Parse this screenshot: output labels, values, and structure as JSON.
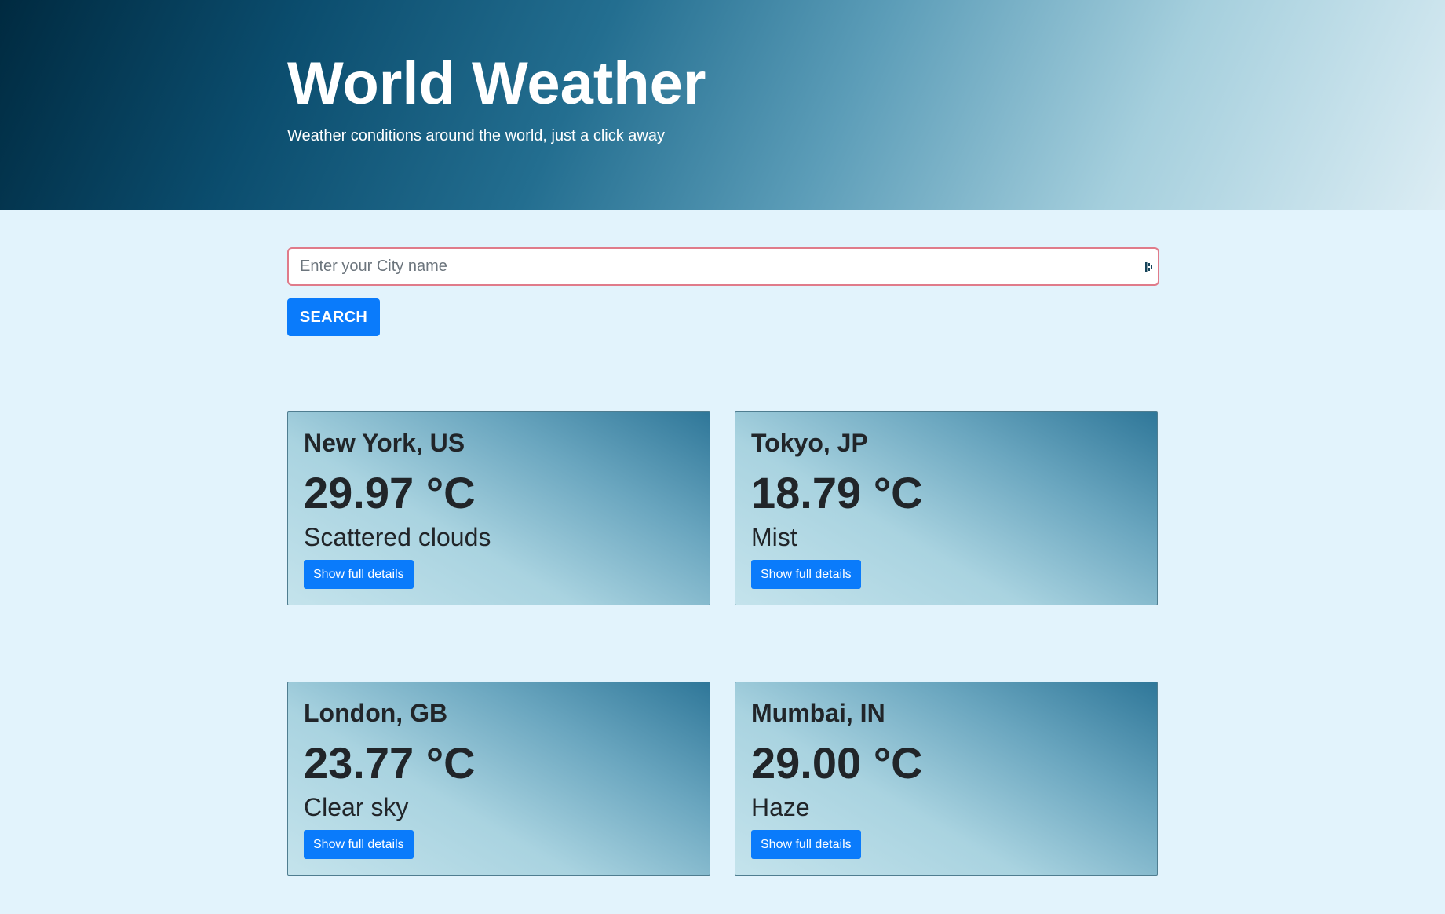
{
  "header": {
    "title": "World Weather",
    "subtitle": "Weather conditions around the world, just a click away"
  },
  "search": {
    "placeholder": "Enter your City name",
    "value": "",
    "button_label": "SEARCH"
  },
  "cards": [
    {
      "city": "New York, US",
      "temperature": "29.97 °C",
      "description": "Scattered clouds",
      "button_label": "Show full details"
    },
    {
      "city": "Tokyo, JP",
      "temperature": "18.79 °C",
      "description": "Mist",
      "button_label": "Show full details"
    },
    {
      "city": "London, GB",
      "temperature": "23.77 °C",
      "description": "Clear sky",
      "button_label": "Show full details"
    },
    {
      "city": "Mumbai, IN",
      "temperature": "29.00 °C",
      "description": "Haze",
      "button_label": "Show full details"
    }
  ],
  "colors": {
    "page_background": "#e2f3fc",
    "primary_button": "#0a7bfb",
    "search_border": "#e07b8a"
  },
  "icons": {
    "search_field_extension": "password-manager-icon"
  }
}
